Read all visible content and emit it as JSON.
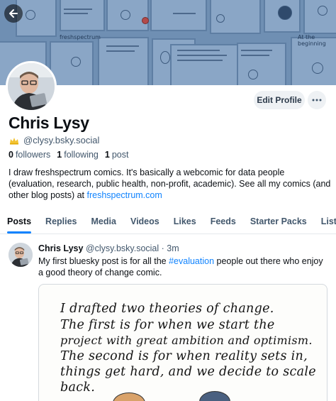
{
  "banner": {
    "texts": [
      "freshspectrum",
      "At the beginning"
    ]
  },
  "header": {
    "edit_profile_label": "Edit Profile"
  },
  "profile": {
    "name": "Chris Lysy",
    "handle": "@clysy.bsky.social",
    "followers_count": "0",
    "followers_label": "followers",
    "following_count": "1",
    "following_label": "following",
    "posts_count": "1",
    "posts_label": "post",
    "bio_text": "I draw freshspectrum comics.  It's basically a webcomic for data people (evaluation, research, public health, non-profit, academic).  See all my comics (and other blog posts) at ",
    "bio_link": "freshspectrum.com"
  },
  "tabs": [
    "Posts",
    "Replies",
    "Media",
    "Videos",
    "Likes",
    "Feeds",
    "Starter Packs",
    "Lists"
  ],
  "post": {
    "author": "Chris Lysy",
    "handle": "@clysy.bsky.social",
    "separator": "·",
    "time": "3m",
    "text_before": "My first bluesky post is for all the ",
    "hashtag": "#evaluation",
    "text_after": " people out there who enjoy a good theory of change comic.",
    "image_lines": [
      "I drafted two theories of change.",
      "The first is for when we start the",
      "project with great ambition and optimism.",
      "The second is for when reality sets in,",
      "things get hard, and we decide to scale",
      "back."
    ]
  },
  "icons": {
    "back": "arrow-left-icon",
    "more": "ellipsis-icon",
    "handle_badge": "sparkle-crown-icon"
  },
  "colors": {
    "accent": "#1083fe",
    "banner": "#6f8fb3"
  }
}
